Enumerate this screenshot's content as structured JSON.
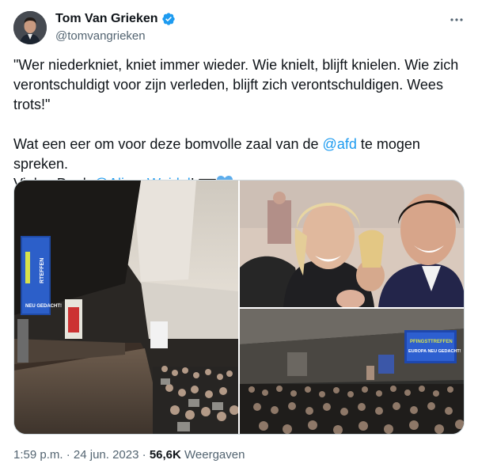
{
  "author": {
    "display_name": "Tom Van Grieken",
    "handle": "@tomvangrieken",
    "verified": true,
    "avatar_icon": "person-avatar"
  },
  "tweet": {
    "quote": "\"Wer niederkniet, kniet immer wieder. Wie knielt, blijft knielen. Wie zich verontschuldigt voor zijn verleden, blijft zich verontschuldigen. Wees trots!\"",
    "line2_prefix": "Wat een eer om voor deze bomvolle zaal van de ",
    "mention_afd": "@afd",
    "line2_suffix": " te mogen spreken.",
    "line3_prefix": "Vielen Dank ",
    "mention_alice": "@Alice_Weidel",
    "line3_suffix": "! ",
    "emojis": [
      "german-flag-icon",
      "blue-heart-icon"
    ]
  },
  "media": {
    "screen_text_main": [
      "RTEFFEN",
      "NEU GEDACHT!"
    ],
    "screen_text_small": [
      "PFINGSTTREFFEN",
      "EUROPA NEU GEDACHT!"
    ]
  },
  "meta": {
    "time": "1:59 p.m.",
    "separator": " · ",
    "date": "24 jun. 2023",
    "views_count": "56,6K",
    "views_label": " Weergaven"
  },
  "colors": {
    "link": "#1d9bf0",
    "verified": "#1d9bf0",
    "secondary_text": "#536471"
  }
}
